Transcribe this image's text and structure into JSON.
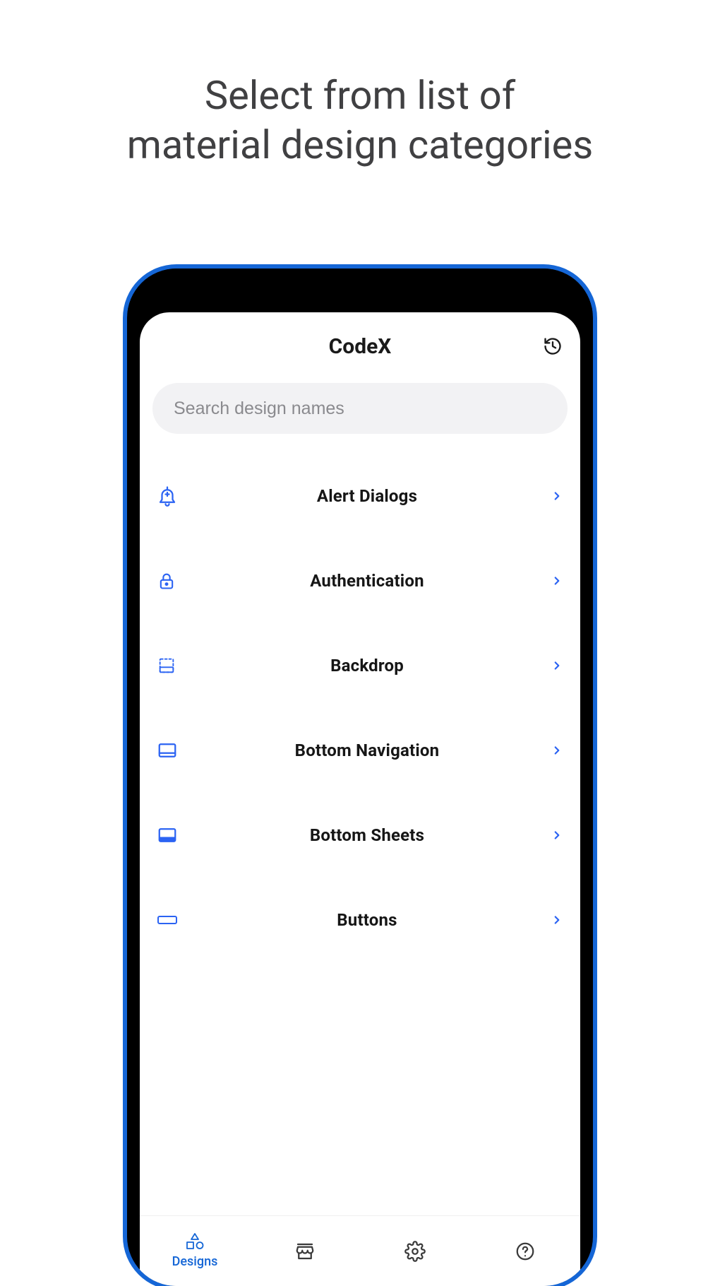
{
  "promo": {
    "line1": "Select from list of",
    "line2": "material design categories"
  },
  "header": {
    "title": "CodeX",
    "history_icon": "history-icon"
  },
  "search": {
    "placeholder": "Search design names",
    "value": ""
  },
  "categories": [
    {
      "icon": "add-alert-icon",
      "label": "Alert Dialogs"
    },
    {
      "icon": "lock-icon",
      "label": "Authentication"
    },
    {
      "icon": "backdrop-icon",
      "label": "Backdrop"
    },
    {
      "icon": "bottom-nav-icon",
      "label": "Bottom Navigation"
    },
    {
      "icon": "bottom-sheet-icon",
      "label": "Bottom Sheets"
    },
    {
      "icon": "button-icon",
      "label": "Buttons"
    }
  ],
  "bottom_nav": {
    "items": [
      {
        "icon": "shapes-icon",
        "label": "Designs",
        "active": true
      },
      {
        "icon": "store-icon",
        "label": "",
        "active": false
      },
      {
        "icon": "settings-icon",
        "label": "",
        "active": false
      },
      {
        "icon": "help-icon",
        "label": "",
        "active": false
      }
    ]
  },
  "colors": {
    "accent": "#1566d6",
    "icon_blue": "#2b63f3",
    "text": "#161616",
    "muted": "#8a8a8e"
  }
}
